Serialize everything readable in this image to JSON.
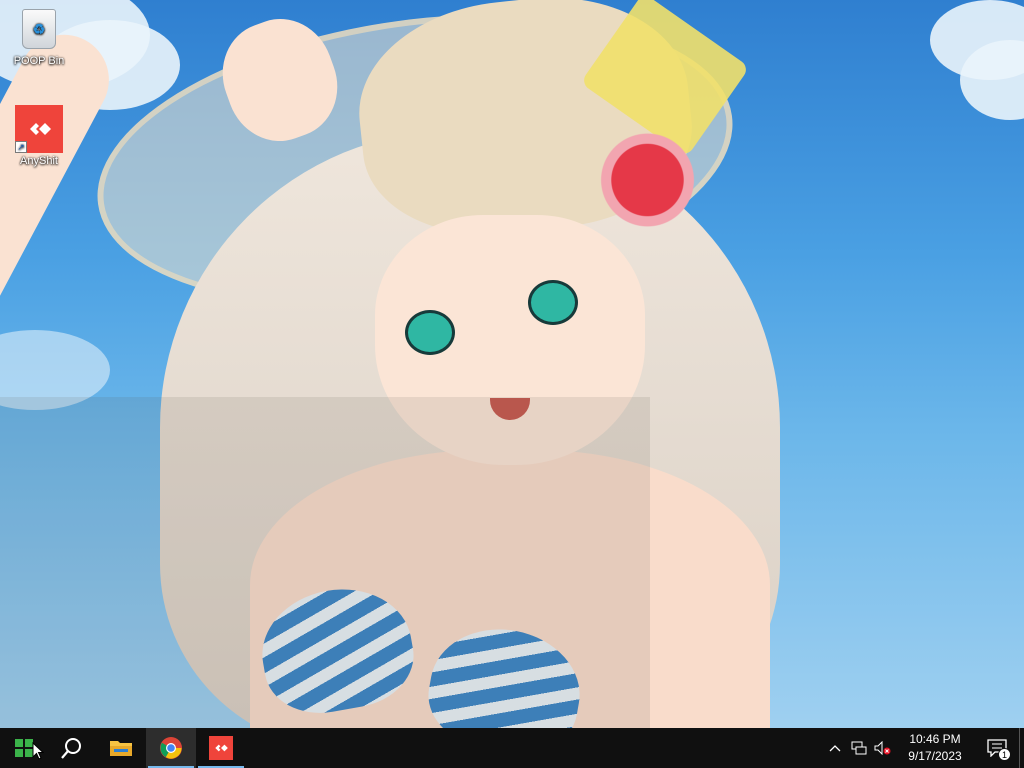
{
  "desktop": {
    "icons": [
      {
        "label": "POOP Bin",
        "icon": "recycle-bin-icon"
      },
      {
        "label": "AnyShit",
        "icon": "anydesk-icon"
      }
    ]
  },
  "taskbar": {
    "start_icon": "windows-logo-icon",
    "search_icon": "search-icon",
    "pinned": [
      {
        "name": "File Explorer",
        "icon": "folder-icon",
        "running": false
      },
      {
        "name": "Google Chrome",
        "icon": "chrome-icon",
        "running": true
      },
      {
        "name": "AnyShit",
        "icon": "anydesk-icon",
        "running": true
      }
    ],
    "tray": {
      "chevron_icon": "chevron-up-icon",
      "network_icon": "network-icon",
      "volume_icon": "volume-muted-icon",
      "time": "10:46 PM",
      "date": "9/17/2023",
      "notifications_count": "1"
    }
  },
  "colors": {
    "taskbar_bg": "#101010",
    "anydesk_red": "#ef443b",
    "running_indicator": "#76b9ed"
  }
}
